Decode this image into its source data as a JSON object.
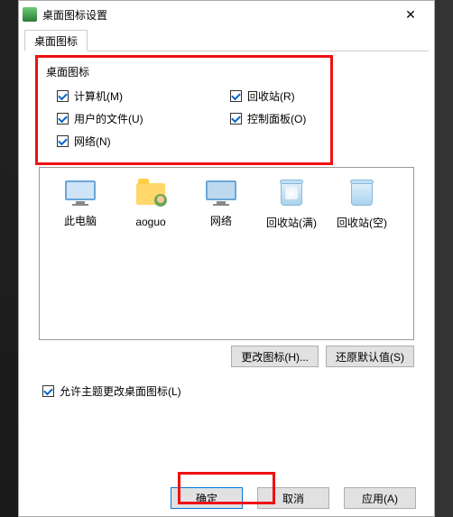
{
  "title": "桌面图标设置",
  "tab": "桌面图标",
  "group_label": "桌面图标",
  "checks": {
    "computer": "计算机(M)",
    "recycle": "回收站(R)",
    "userfiles": "用户的文件(U)",
    "control": "控制面板(O)",
    "network": "网络(N)"
  },
  "preview": {
    "thispc": "此电脑",
    "user": "aoguo",
    "network": "网络",
    "bin_full": "回收站(满)",
    "bin_empty": "回收站(空)"
  },
  "buttons": {
    "change_icon": "更改图标(H)...",
    "restore_default": "还原默认值(S)"
  },
  "allow_theme": "允许主题更改桌面图标(L)",
  "footer": {
    "ok": "确定",
    "cancel": "取消",
    "apply": "应用(A)"
  }
}
